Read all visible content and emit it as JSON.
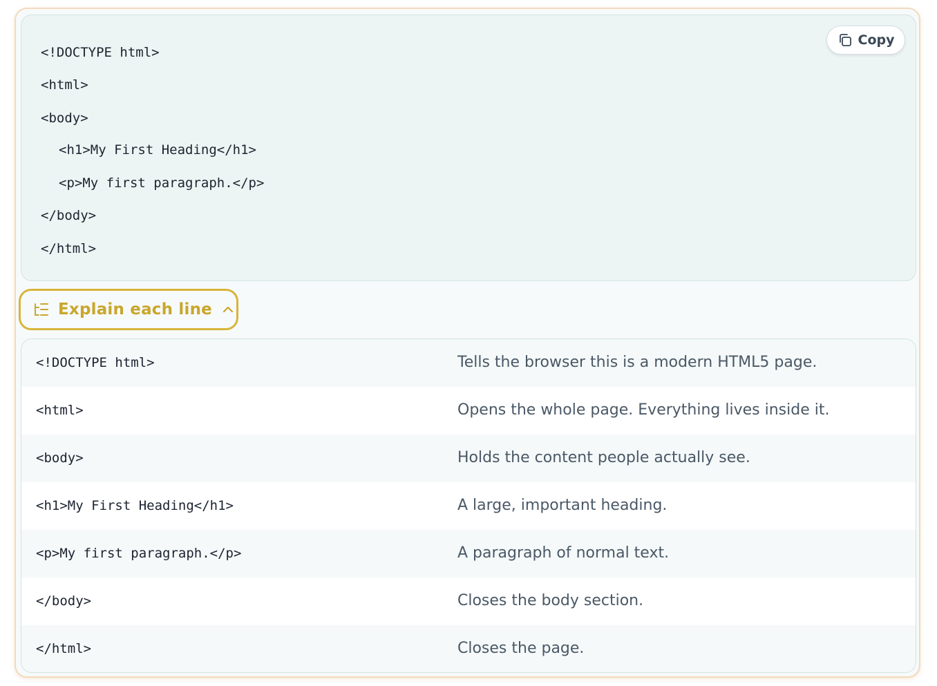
{
  "code_block": {
    "lines": [
      "<!DOCTYPE html>",
      "<html>",
      "<body>",
      "<h1>My First Heading</h1>",
      "<p>My first paragraph.</p>",
      "</body>",
      "</html>"
    ],
    "copy_button": {
      "label": "Copy",
      "icon": "copy-icon"
    }
  },
  "explain_toggle": {
    "label": "Explain each line",
    "icon": "list-tree-icon",
    "chevron_icon": "chevron-up-icon",
    "expanded": true,
    "accent_color": "#d8b43a"
  },
  "explanations": {
    "rows": [
      {
        "code": "<!DOCTYPE html>",
        "description": "Tells the browser this is a modern HTML5 page."
      },
      {
        "code": "<html>",
        "description": "Opens the whole page. Everything lives inside it."
      },
      {
        "code": "<body>",
        "description": "Holds the content people actually see."
      },
      {
        "code": "<h1>My First Heading</h1>",
        "description": "A large, important heading."
      },
      {
        "code": "<p>My first paragraph.</p>",
        "description": "A paragraph of normal text."
      },
      {
        "code": "</body>",
        "description": "Closes the body section."
      },
      {
        "code": "</html>",
        "description": "Closes the page."
      }
    ]
  }
}
